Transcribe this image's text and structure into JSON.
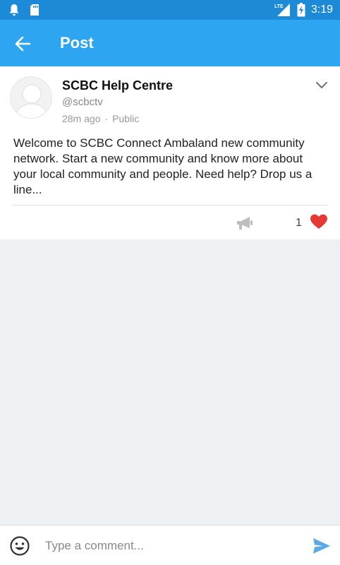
{
  "status_bar": {
    "time": "3:19",
    "network": "LTE"
  },
  "app_bar": {
    "title": "Post"
  },
  "post": {
    "author_name": "SCBC Help Centre",
    "author_handle": "@scbctv",
    "time_ago": "28m ago",
    "separator": "·",
    "visibility": "Public",
    "body": "Welcome to SCBC Connect Ambaland new community network. Start a new community and know more about your local community and people. Need help? Drop us a line...",
    "like_count": "1"
  },
  "comment": {
    "placeholder": "Type a comment..."
  },
  "colors": {
    "status_bar": "#1c8ad6",
    "app_bar": "#2ea5f1",
    "heart": "#e53935",
    "send": "#5aa9e6"
  },
  "icons": [
    "notification-icon",
    "sd-card-icon",
    "lte-signal-icon",
    "battery-charging-icon",
    "back-arrow-icon",
    "avatar-placeholder-icon",
    "chevron-down-icon",
    "megaphone-icon",
    "heart-icon",
    "emoji-icon",
    "send-icon"
  ]
}
